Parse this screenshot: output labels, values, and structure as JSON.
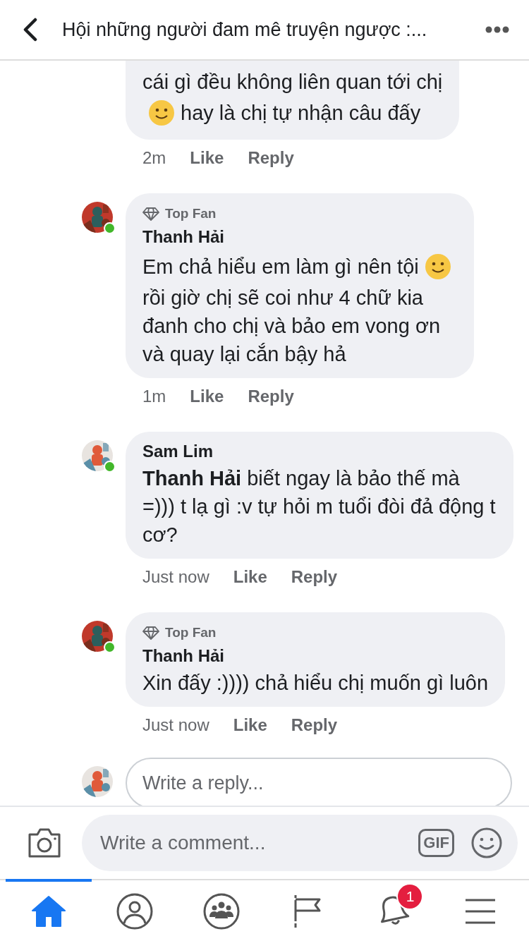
{
  "header": {
    "title": "Hội những người đam mê truyện ngược :..."
  },
  "comments": [
    {
      "lines": [
        [
          {
            "kind": "text",
            "text": "cái gì đều không liên quan tới chị"
          }
        ],
        [
          {
            "kind": "emoji"
          },
          {
            "kind": "text",
            "text": "hay là chị tự nhận câu đấy"
          }
        ]
      ],
      "time": "2m",
      "actions": [
        "Like",
        "Reply"
      ]
    },
    {
      "author": "Thanh Hải",
      "badge": "Top Fan",
      "online": true,
      "lines": [
        [
          {
            "kind": "text",
            "text": "Em chả hiểu em làm gì nên tội"
          },
          {
            "kind": "emoji"
          }
        ],
        [
          {
            "kind": "text",
            "text": "rồi giờ chị sẽ coi như 4 chữ kia"
          }
        ],
        [
          {
            "kind": "text",
            "text": "đanh cho chị và bảo em vong ơn"
          }
        ],
        [
          {
            "kind": "text",
            "text": "và quay lại cắn bậy hả"
          }
        ]
      ],
      "time": "1m",
      "actions": [
        "Like",
        "Reply"
      ]
    },
    {
      "author": "Sam Lim",
      "online": true,
      "lines": [
        [
          {
            "kind": "text",
            "text": "**Thanh Hải** biết ngay là bảo thế mà =))) t lạ gì :v tự hỏi m tuổi đòi đả động t cơ?"
          }
        ]
      ],
      "time": "Just now",
      "actions": [
        "Like",
        "Reply"
      ]
    },
    {
      "author": "Thanh Hải",
      "badge": "Top Fan",
      "online": true,
      "lines": [
        [
          {
            "kind": "text",
            "text": "Xin đấy :)))) chả hiểu chị muốn gì luôn"
          }
        ]
      ],
      "time": "Just now",
      "actions": [
        "Like",
        "Reply"
      ]
    }
  ],
  "reply_field": {
    "placeholder": "Write a reply..."
  },
  "composer": {
    "placeholder": "Write a comment...",
    "gif": "GIF"
  },
  "tabs": [
    {
      "kind": "home",
      "selected": true
    },
    {
      "kind": "profile",
      "selected": false
    },
    {
      "kind": "groups",
      "selected": false
    },
    {
      "kind": "pages",
      "selected": false
    },
    {
      "kind": "notifications",
      "selected": false,
      "badge": "1"
    },
    {
      "kind": "menu",
      "selected": false
    }
  ]
}
